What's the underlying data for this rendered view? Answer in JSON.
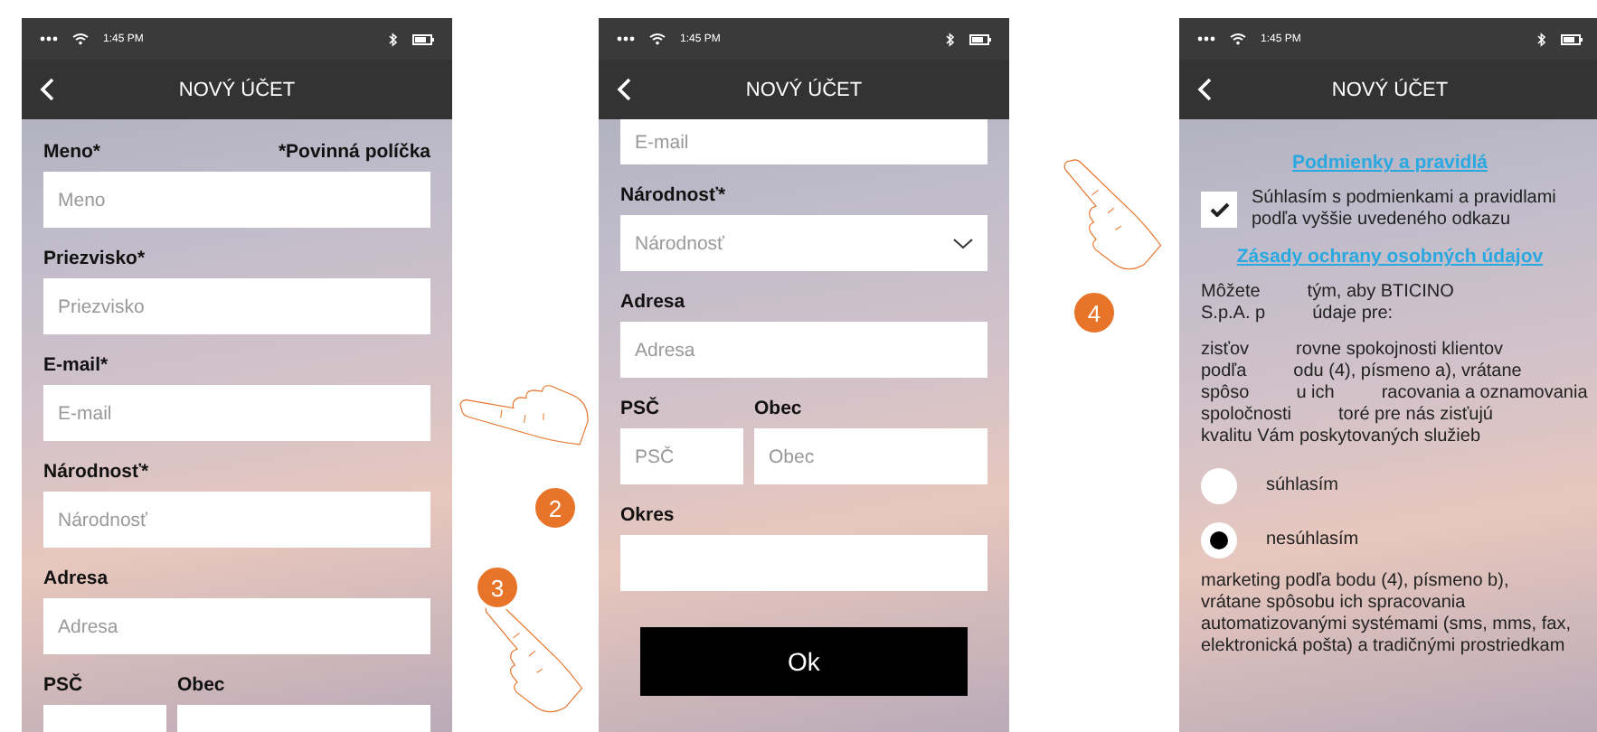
{
  "screens": [
    {
      "time": "1:45 PM",
      "title": "NOVÝ ÚČET",
      "items": [
        {
          "kind": "label",
          "text": "Meno*",
          "note": "*Povinná políčka"
        },
        {
          "kind": "field",
          "placeholder": "Meno"
        },
        {
          "kind": "label",
          "text": "Priezvisko*"
        },
        {
          "kind": "field",
          "placeholder": "Priezvisko"
        },
        {
          "kind": "label",
          "text": "E-mail*"
        },
        {
          "kind": "field",
          "placeholder": "E-mail"
        },
        {
          "kind": "label",
          "text": "Národnosť*"
        },
        {
          "kind": "field",
          "placeholder": "Národnosť"
        },
        {
          "kind": "label",
          "text": "Adresa"
        },
        {
          "kind": "field",
          "placeholder": "Adresa"
        },
        {
          "kind": "pair_labels",
          "texts": [
            "PSČ",
            "Obec"
          ]
        },
        {
          "kind": "pair_fields"
        }
      ]
    },
    {
      "time": "1:45 PM",
      "title": "NOVÝ ÚČET",
      "items": [
        {
          "kind": "top_field",
          "placeholder": "E-mail"
        },
        {
          "kind": "label",
          "text": "Národnosť*"
        },
        {
          "kind": "select",
          "placeholder": "Národnosť"
        },
        {
          "kind": "label",
          "text": "Adresa"
        },
        {
          "kind": "field",
          "placeholder": "Adresa"
        },
        {
          "kind": "pair_labels",
          "texts": [
            "PSČ",
            "Obec"
          ]
        },
        {
          "kind": "pair_fields",
          "placeholders": [
            "PSČ",
            "Obec"
          ]
        },
        {
          "kind": "label",
          "text": "Okres"
        },
        {
          "kind": "field"
        },
        {
          "kind": "button",
          "text": "Ok"
        }
      ]
    },
    {
      "time": "1:45 PM",
      "title": "NOVÝ ÚČET",
      "items": [
        {
          "kind": "link",
          "text": "Podmienky a pravidlá"
        },
        {
          "kind": "checkbox",
          "checked": true,
          "lines": [
            "Súhlasím s podmienkami a pravidlami",
            "podľa vyššie uvedeného odkazu"
          ]
        },
        {
          "kind": "link",
          "text": "Zásady ochrany osobných údajov"
        },
        {
          "kind": "lines",
          "lines": [
            [
              "Môžete",
              "tým, aby BTICINO"
            ],
            [
              "S.p.A. p",
              "údaje pre:"
            ]
          ]
        },
        {
          "kind": "lines",
          "lines": [
            [
              "zisťov",
              "rovne spokojnosti klientov"
            ],
            [
              "podľa",
              "odu (4), písmeno a), vrátane"
            ],
            [
              "spôso",
              "u ich",
              "racovania a oznamovania"
            ],
            [
              "spoločnosti",
              "toré pre nás zisťujú"
            ],
            [
              "kvalitu Vám poskytovaných služieb"
            ]
          ]
        },
        {
          "kind": "radio",
          "text": "súhlasím",
          "selected": false
        },
        {
          "kind": "radio",
          "text": "nesúhlasím",
          "selected": true
        },
        {
          "kind": "lines",
          "lines": [
            [
              "marketing podľa bodu (4), písmeno b),"
            ],
            [
              "vrátane spôsobu ich spracovania"
            ],
            [
              "automatizovanými systémami (sms, mms, fax,"
            ],
            [
              "elektronická pošta) a tradičnými prostriedkam"
            ]
          ]
        }
      ]
    }
  ],
  "callouts": [
    {
      "number": "2"
    },
    {
      "number": "3"
    },
    {
      "number": "4"
    }
  ]
}
